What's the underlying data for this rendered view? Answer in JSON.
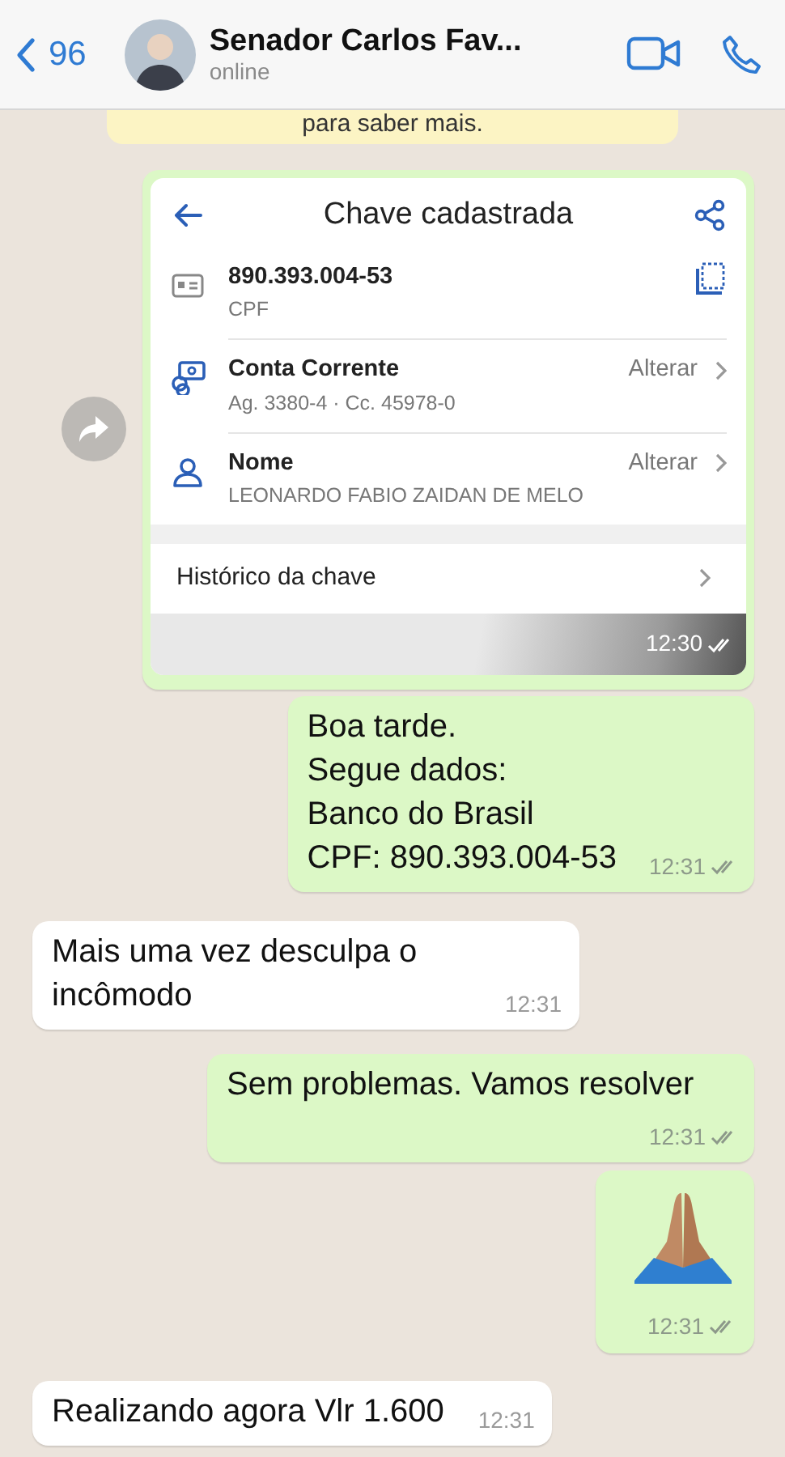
{
  "header": {
    "back_count": "96",
    "contact_name": "Senador Carlos Fav...",
    "status": "online"
  },
  "notice": {
    "text": "para saber mais."
  },
  "messages": [
    {
      "kind": "screenshot",
      "outgoing": true,
      "forwardable": true,
      "time": "12:30",
      "delivered": true,
      "screen": {
        "title": "Chave cadastrada",
        "rows": [
          {
            "kind": "key",
            "title": "890.393.004-53",
            "subtitle": "CPF"
          },
          {
            "kind": "account",
            "title": "Conta Corrente",
            "subtitle": "Ag. 3380-4 · Cc. 45978-0",
            "action": "Alterar"
          },
          {
            "kind": "person",
            "title": "Nome",
            "subtitle": "LEONARDO FABIO ZAIDAN DE MELO",
            "action": "Alterar"
          }
        ],
        "history": "Histórico da chave"
      }
    },
    {
      "kind": "text",
      "outgoing": true,
      "text": "Boa tarde.\nSegue dados:\nBanco do Brasil\nCPF: 890.393.004-53",
      "time": "12:31",
      "delivered": true
    },
    {
      "kind": "text",
      "outgoing": false,
      "text": "Mais uma vez desculpa o incômodo",
      "time": "12:31"
    },
    {
      "kind": "text",
      "outgoing": true,
      "text": "Sem problemas. Vamos resolver",
      "time": "12:31",
      "delivered": true
    },
    {
      "kind": "emoji",
      "outgoing": true,
      "time": "12:31",
      "delivered": true
    },
    {
      "kind": "text",
      "outgoing": false,
      "text": "Realizando agora Vlr 1.600",
      "time": "12:31"
    }
  ]
}
